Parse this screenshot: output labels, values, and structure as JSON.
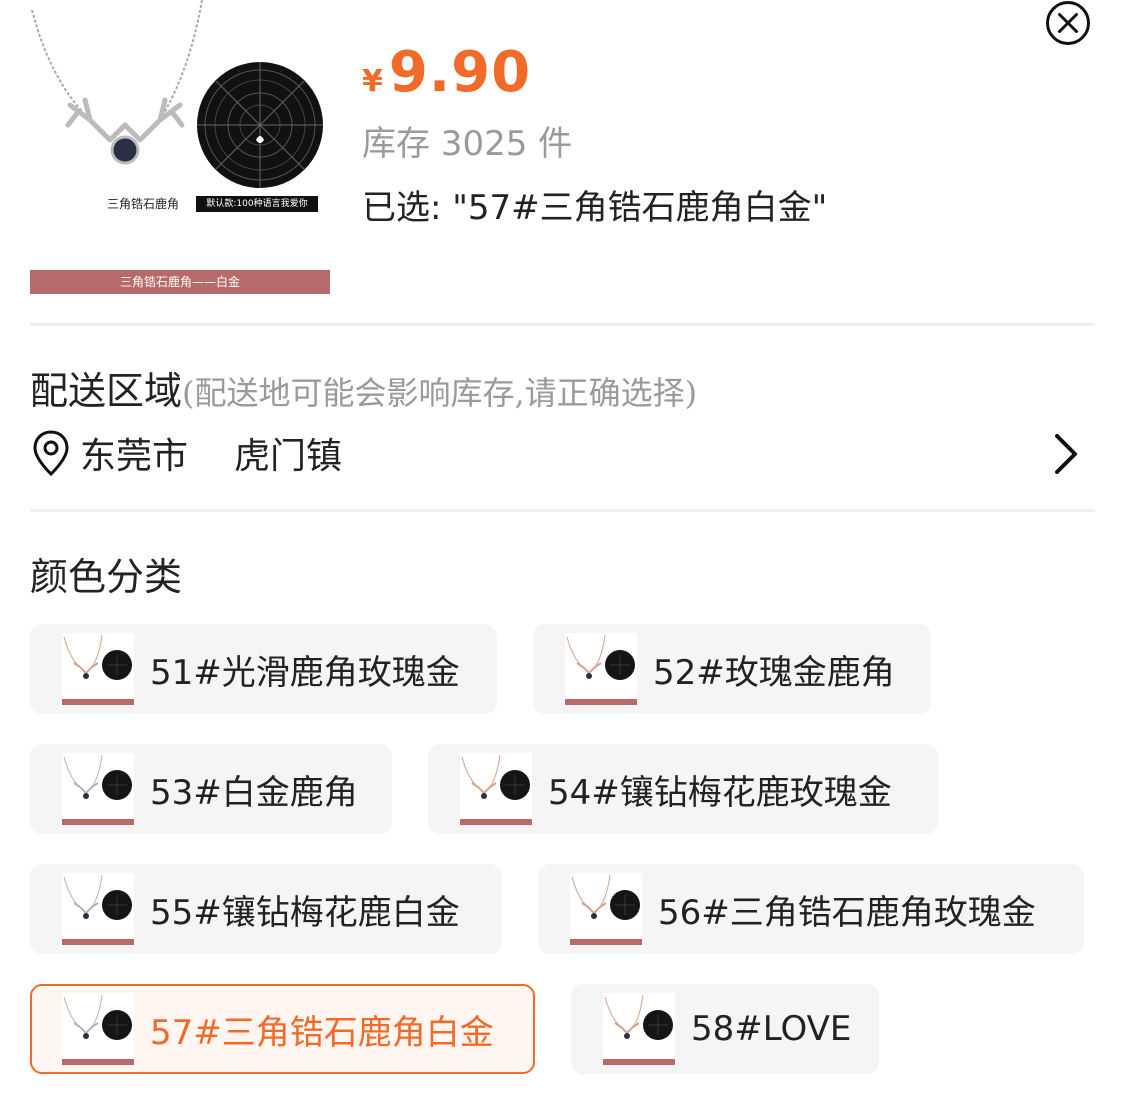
{
  "product": {
    "image_caption_left": "三角锆石鹿角",
    "image_caption_right": "默认款:100种语言我爱你",
    "image_banner": "三角锆石鹿角——白金",
    "currency": "¥",
    "price": "9.90",
    "stock": "库存 3025 件",
    "selected": "已选: \"57#三角锆石鹿角白金\"",
    "price_color": "#f06a2a"
  },
  "delivery": {
    "title": "配送区域",
    "note": "(配送地可能会影响库存,请正确选择)",
    "city": "东莞市",
    "town": "虎门镇"
  },
  "colors": {
    "title": "颜色分类",
    "options": [
      {
        "label": "51#光滑鹿角玫瑰金",
        "selected": false
      },
      {
        "label": "52#玫瑰金鹿角",
        "selected": false
      },
      {
        "label": "53#白金鹿角",
        "selected": false
      },
      {
        "label": "54#镶钻梅花鹿玫瑰金",
        "selected": false
      },
      {
        "label": "55#镶钻梅花鹿白金",
        "selected": false
      },
      {
        "label": "56#三角锆石鹿角玫瑰金",
        "selected": false
      },
      {
        "label": "57#三角锆石鹿角白金",
        "selected": true
      },
      {
        "label": "58#LOVE",
        "selected": false
      }
    ]
  }
}
